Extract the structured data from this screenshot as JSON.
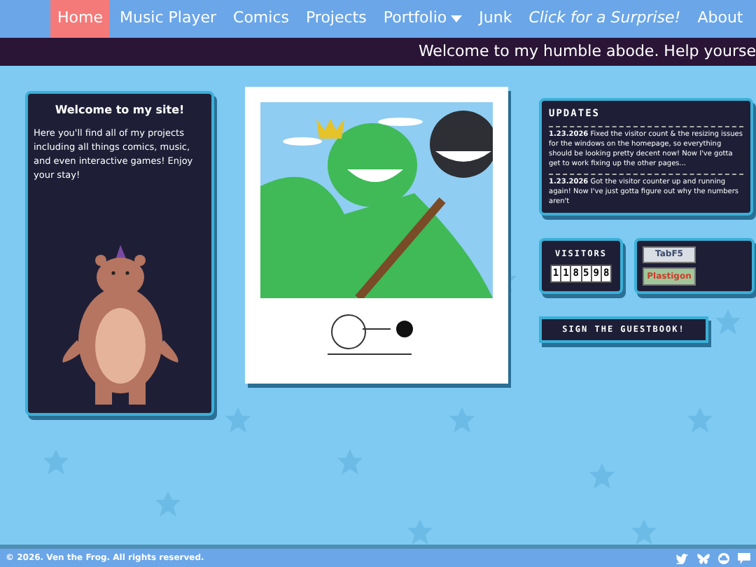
{
  "nav": [
    {
      "label": "Home",
      "selected": true,
      "kind": "link"
    },
    {
      "label": "Music Player",
      "selected": false,
      "kind": "link"
    },
    {
      "label": "Comics",
      "selected": false,
      "kind": "link"
    },
    {
      "label": "Projects",
      "selected": false,
      "kind": "link"
    },
    {
      "label": "Portfolio",
      "selected": false,
      "kind": "dropdown"
    },
    {
      "label": "Junk",
      "selected": false,
      "kind": "link"
    },
    {
      "label": "Click for a Surprise!",
      "selected": false,
      "kind": "special"
    },
    {
      "label": "About",
      "selected": false,
      "kind": "link"
    }
  ],
  "marquee": "Welcome to my humble abode. Help yourse",
  "welcome": {
    "title": "Welcome to my site!",
    "text": "Here you'll find all of my projects including all things comics, music, and even interactive games! Enjoy your stay!"
  },
  "updates": {
    "title": "UPDATES",
    "entries": [
      {
        "date": "1.23.2026",
        "text": "Fixed the visitor count & the resizing issues for the windows on the homepage, so everything should be looking pretty decent now! Now I've gotta get to work fixing up the other pages..."
      },
      {
        "date": "1.23.2026",
        "text": "Got the visitor counter up and running again! Now I've just gotta figure out why the numbers aren't"
      }
    ]
  },
  "visitors": {
    "title": "VISITORS",
    "digits": [
      "1",
      "1",
      "8",
      "5",
      "9",
      "8"
    ]
  },
  "badges": [
    {
      "label": "TabF5",
      "kind": "arrows"
    },
    {
      "label": "Plastigon",
      "kind": "logo"
    }
  ],
  "guestbook": "SIGN THE GUESTBOOK!",
  "footer": {
    "copyright": "© 2026. Ven the Frog. All rights reserved."
  }
}
